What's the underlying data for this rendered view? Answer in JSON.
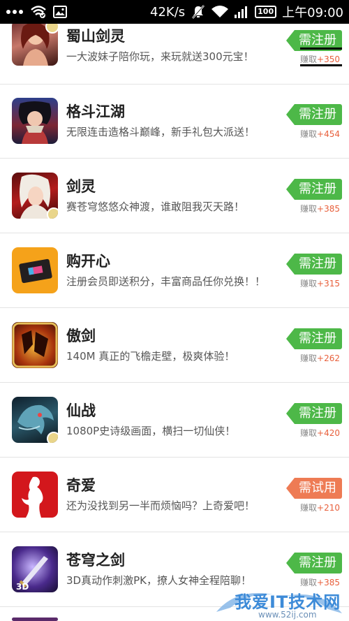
{
  "status_bar": {
    "menu_icon": "more-dots-icon",
    "left_icons": [
      "wifi-check-icon",
      "image-icon"
    ],
    "network_speed": "42K/s",
    "battery": "100",
    "time": "上午09:00"
  },
  "apps": [
    {
      "title": "蜀山剑灵",
      "desc": "一大波妹子陪你玩，来玩就送300元宝！",
      "tag": "需注册",
      "tag_color": "green",
      "reward_label": "赚取",
      "reward_points": "+350",
      "icon": "shushan-game-icon"
    },
    {
      "title": "格斗江湖",
      "desc": "无限连击造格斗巅峰，新手礼包大派送！",
      "tag": "需注册",
      "tag_color": "green",
      "reward_label": "赚取",
      "reward_points": "+454",
      "icon": "gedou-game-icon"
    },
    {
      "title": "剑灵",
      "desc": "赛苍穹悠悠众神渡，谁敢阻我灭天路！",
      "tag": "需注册",
      "tag_color": "green",
      "reward_label": "赚取",
      "reward_points": "+385",
      "icon": "jianling-game-icon"
    },
    {
      "title": "购开心",
      "desc": "注册会员即送积分，丰富商品任你兑换！！",
      "tag": "需注册",
      "tag_color": "green",
      "reward_label": "赚取",
      "reward_points": "+315",
      "icon": "shopping-card-icon"
    },
    {
      "title": "傲剑",
      "desc": "140M 真正的飞檐走壁，极爽体验！",
      "tag": "需注册",
      "tag_color": "green",
      "reward_label": "赚取",
      "reward_points": "+262",
      "icon": "aojian-game-icon"
    },
    {
      "title": "仙战",
      "desc": "1080P史诗级画面，横扫一切仙侠！",
      "tag": "需注册",
      "tag_color": "green",
      "reward_label": "赚取",
      "reward_points": "+420",
      "icon": "xianzhan-game-icon"
    },
    {
      "title": "奇爱",
      "desc": "还为没找到另一半而烦恼吗？上奇爱吧！",
      "tag": "需试用",
      "tag_color": "orange",
      "reward_label": "赚取",
      "reward_points": "+210",
      "icon": "qiai-silhouette-icon"
    },
    {
      "title": "苍穹之剑",
      "desc": "3D真动作刺激PK，撩人女神全程陪聊！",
      "tag": "需注册",
      "tag_color": "green",
      "reward_label": "赚取",
      "reward_points": "+385",
      "icon": "cangqiong-sword-icon"
    }
  ],
  "watermark": {
    "text": "我爱IT技术网",
    "url": "www.52ij.com"
  },
  "colors": {
    "green_tag": "#4db848",
    "orange_tag": "#ee7b54",
    "reward": "#e8603c"
  }
}
